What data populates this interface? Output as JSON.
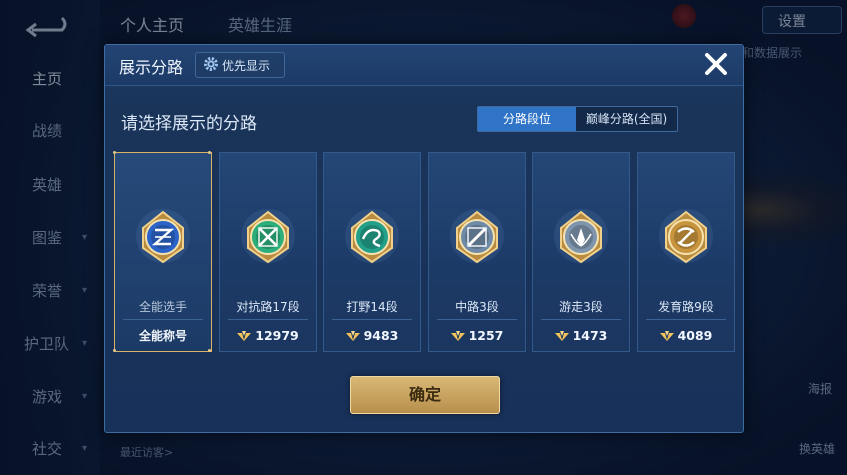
{
  "background": {
    "tabs": [
      "个人主页",
      "英雄生涯"
    ],
    "settings_label": "设置",
    "right_hint": "和数据展示",
    "right_buttons": [
      "海报",
      "换英雄"
    ],
    "bottom_hint": "最近访客>",
    "sidebar": [
      {
        "label": "主页",
        "chevron": false
      },
      {
        "label": "战绩",
        "chevron": false
      },
      {
        "label": "英雄",
        "chevron": false
      },
      {
        "label": "图鉴",
        "chevron": true
      },
      {
        "label": "荣誉",
        "chevron": true
      },
      {
        "label": "护卫队",
        "chevron": true
      },
      {
        "label": "游戏",
        "chevron": true
      },
      {
        "label": "社交",
        "chevron": true
      }
    ]
  },
  "modal": {
    "title": "展示分路",
    "priority_button": "优先显示",
    "subtitle": "请选择展示的分路",
    "segments": [
      "分路段位",
      "巅峰分路(全国)"
    ],
    "active_segment": "分路段位",
    "cards": [
      {
        "name": "全能选手",
        "footer": "全能称号",
        "points": "",
        "icon": "allround-emblem-icon",
        "selected": true,
        "color": "#2b63c9"
      },
      {
        "name": "对抗路17段",
        "footer": "",
        "points": "12979",
        "icon": "clash-lane-emblem-icon",
        "selected": false,
        "color": "#2cae7a"
      },
      {
        "name": "打野14段",
        "footer": "",
        "points": "9483",
        "icon": "jungle-emblem-icon",
        "selected": false,
        "color": "#23a08a"
      },
      {
        "name": "中路3段",
        "footer": "",
        "points": "1257",
        "icon": "mid-lane-emblem-icon",
        "selected": false,
        "color": "#6f8aa6"
      },
      {
        "name": "游走3段",
        "footer": "",
        "points": "1473",
        "icon": "roam-emblem-icon",
        "selected": false,
        "color": "#7e95ad"
      },
      {
        "name": "发育路9段",
        "footer": "",
        "points": "4089",
        "icon": "farm-lane-emblem-icon",
        "selected": false,
        "color": "#c8953e"
      }
    ],
    "confirm_label": "确定"
  }
}
